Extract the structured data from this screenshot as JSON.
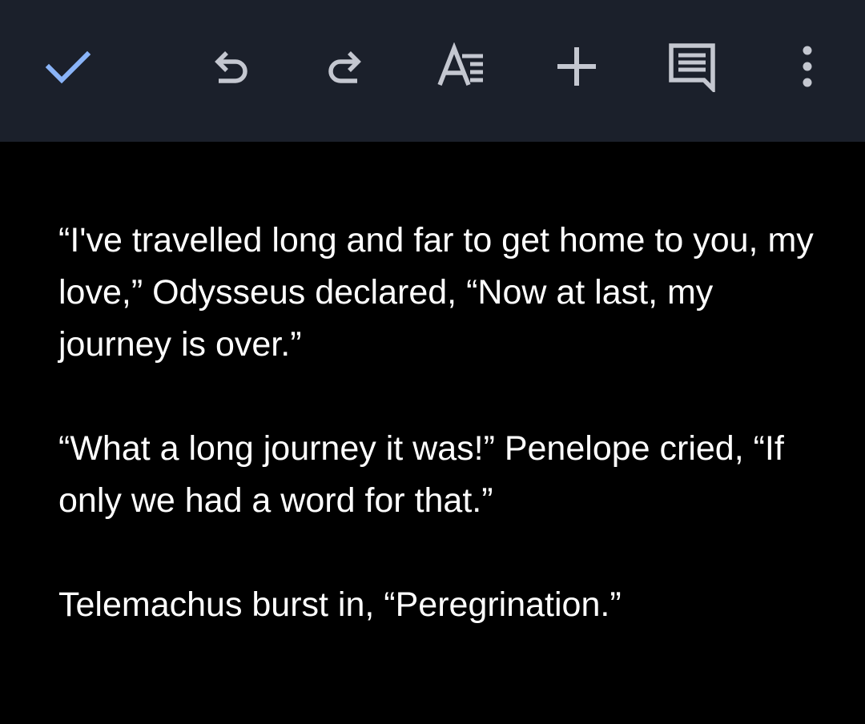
{
  "toolbar": {
    "icons": {
      "done": "check-icon",
      "undo": "undo-icon",
      "redo": "redo-icon",
      "format": "text-format-icon",
      "insert": "plus-icon",
      "comment": "comment-icon",
      "more": "more-vert-icon"
    },
    "colors": {
      "background": "#1b202b",
      "check": "#8ab4f8",
      "icon": "#c4c7d0"
    }
  },
  "document": {
    "paragraphs": [
      "“I've travelled long and far to get home to you, my love,” Odysseus declared, “Now at last, my journey is over.”",
      "“What a long journey it was!” Penelope cried, “If only we had a word for that.”",
      "Telemachus burst in, “Peregrination.”"
    ],
    "colors": {
      "background": "#000000",
      "text": "#ffffff"
    }
  }
}
